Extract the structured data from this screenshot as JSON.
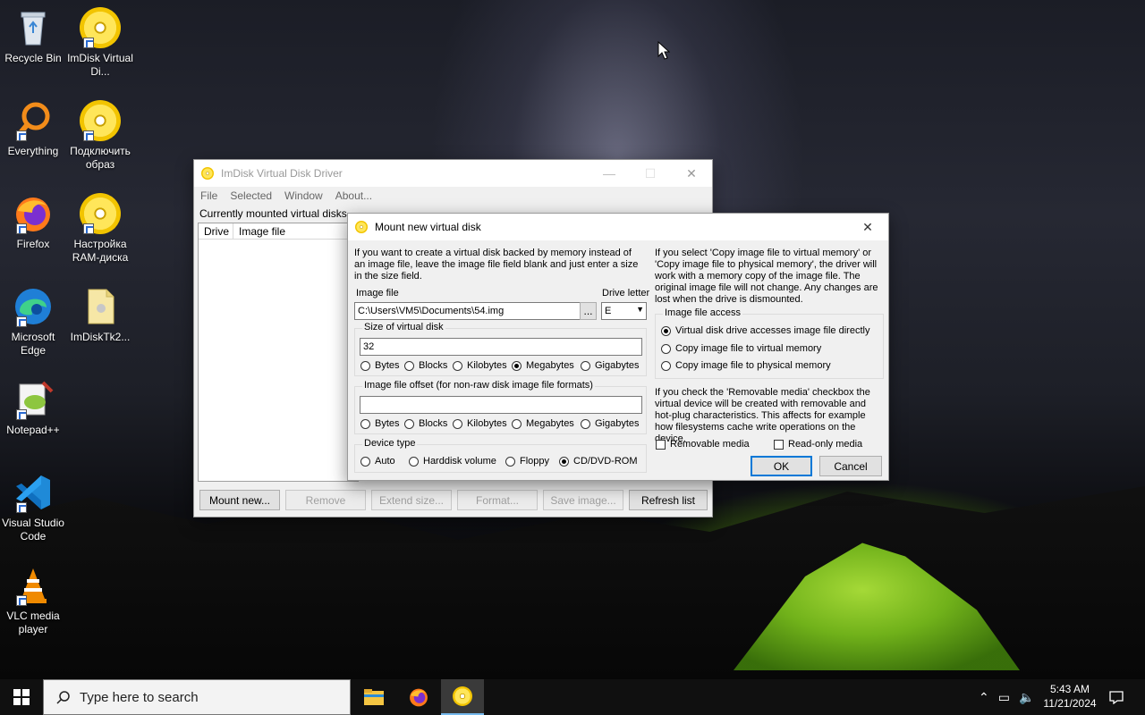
{
  "desktop": {
    "icons": [
      {
        "label": "Recycle Bin",
        "icon": "recycle-bin-icon"
      },
      {
        "label": "ImDisk Virtual Di...",
        "icon": "imdisk-disc-icon"
      },
      {
        "label": "Everything",
        "icon": "everything-search-icon"
      },
      {
        "label": "Подключить образ",
        "icon": "imdisk-disc-icon"
      },
      {
        "label": "Firefox",
        "icon": "firefox-icon"
      },
      {
        "label": "Настройка RAM-диска",
        "icon": "imdisk-disc-icon"
      },
      {
        "label": "Microsoft Edge",
        "icon": "edge-icon"
      },
      {
        "label": "ImDiskTk2...",
        "icon": "file-icon"
      },
      {
        "label": "Notepad++",
        "icon": "notepadpp-icon"
      },
      {
        "label": "Visual Studio Code",
        "icon": "vscode-icon"
      },
      {
        "label": "VLC media player",
        "icon": "vlc-icon"
      }
    ]
  },
  "main_window": {
    "title": "ImDisk Virtual Disk Driver",
    "menu": [
      "File",
      "Selected",
      "Window",
      "About..."
    ],
    "list_caption": "Currently mounted virtual disks",
    "columns": [
      "Drive",
      "Image file"
    ],
    "buttons": {
      "mount": "Mount new...",
      "remove": "Remove",
      "extend": "Extend size...",
      "format": "Format...",
      "save": "Save image...",
      "refresh": "Refresh list"
    }
  },
  "dialog": {
    "title": "Mount new virtual disk",
    "intro": "If you want to create a virtual disk backed by memory instead of an image file, leave the image file field blank and just enter a size in the size field.",
    "image_file_label": "Image file",
    "image_file_value": "C:\\Users\\VM5\\Documents\\54.img",
    "browse_label": "...",
    "drive_letter_label": "Drive letter",
    "drive_letter_value": "E",
    "size_group": "Size of virtual disk",
    "size_value": "32",
    "size_units": [
      "Bytes",
      "Blocks",
      "Kilobytes",
      "Megabytes",
      "Gigabytes"
    ],
    "size_selected": "Megabytes",
    "offset_group": "Image file offset (for non-raw disk image file formats)",
    "offset_value": "",
    "offset_units": [
      "Bytes",
      "Blocks",
      "Kilobytes",
      "Megabytes",
      "Gigabytes"
    ],
    "device_group": "Device type",
    "device_types": [
      "Auto",
      "Harddisk volume",
      "Floppy",
      "CD/DVD-ROM"
    ],
    "device_selected": "CD/DVD-ROM",
    "copy_note": "If you select 'Copy image file to virtual memory' or 'Copy image file to physical memory', the driver will work with a memory copy of the image file. The original image file will not change. Any changes are lost when the drive is dismounted.",
    "access_group": "Image file access",
    "access_options": [
      "Virtual disk drive accesses image file directly",
      "Copy image file to virtual memory",
      "Copy image file to physical memory"
    ],
    "access_selected": "Virtual disk drive accesses image file directly",
    "removable_note": "If you check the 'Removable media' checkbox the virtual device will be created with removable and hot-plug characteristics. This affects for example how filesystems cache write operations on the device.",
    "removable_label": "Removable media",
    "readonly_label": "Read-only media",
    "ok_label": "OK",
    "cancel_label": "Cancel"
  },
  "taskbar": {
    "search_placeholder": "Type here to search",
    "time": "5:43 AM",
    "date": "11/21/2024"
  }
}
